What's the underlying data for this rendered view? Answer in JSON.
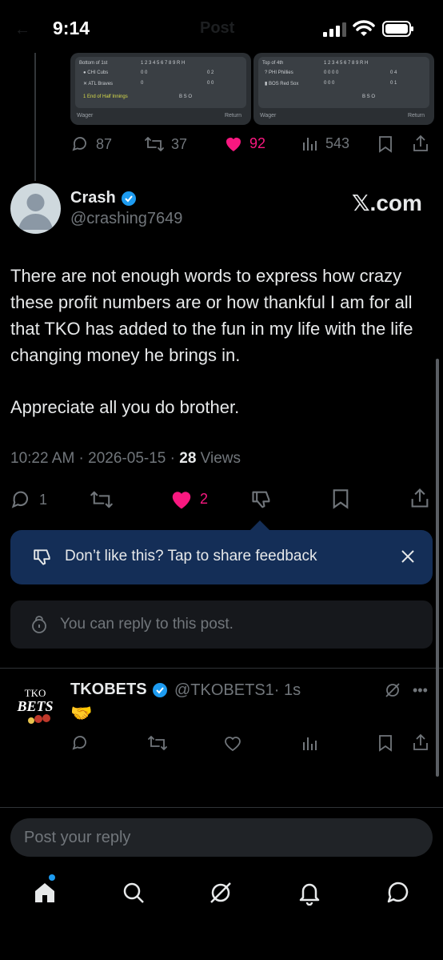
{
  "status_bar": {
    "time": "9:14",
    "ghost_title": "Post"
  },
  "quoted_cards": [
    {
      "inning": "Bottom of 1st",
      "innings_header": "1 2 3 4 5 6 7 8 9 R H",
      "teams": [
        {
          "name": "CHI Cubs",
          "scores": "0 0",
          "rh": "0 2"
        },
        {
          "name": "ATL Braves",
          "scores": "0",
          "rh": "0 0"
        }
      ],
      "status": "1 End of Half Innings",
      "count": "B S O",
      "wager_label": "Wager",
      "return_label": "Return"
    },
    {
      "inning": "Top of 4th",
      "innings_header": "1 2 3 4 5 6 7 8 9 R H",
      "teams": [
        {
          "name": "PHI Phillies",
          "scores": "0 0 0 0",
          "rh": "0 4"
        },
        {
          "name": "BOS Red Sox",
          "scores": "0 0 0",
          "rh": "0 1"
        }
      ],
      "count": "B S O",
      "wager_label": "Wager",
      "return_label": "Return"
    }
  ],
  "parent_actions": {
    "replies": "87",
    "reposts": "37",
    "likes": "92",
    "views": "543"
  },
  "post": {
    "author_name": "Crash",
    "author_handle": "@crashing7649",
    "source_mark": "𝕏.com",
    "text_line1": "There are not enough words to express how crazy these profit numbers are or how thankful I am for all that TKO has added to the fun in my life with the life changing money he brings in.",
    "text_line2": "Appreciate all you do brother.",
    "timestamp": "10:22 AM · 2026-05-15 · ",
    "views_count": "28",
    "views_label": " Views",
    "replies": "1",
    "likes": "2"
  },
  "feedback_banner": {
    "text": "Don’t like this? Tap to share feedback"
  },
  "reply_restriction": {
    "text": "You can reply to this post."
  },
  "reply": {
    "logo_top": "TKO",
    "logo_bottom": "BETS",
    "author_name": "TKOBETS",
    "author_handle": "@TKOBETS1",
    "time": "· 1s",
    "text": "🤝"
  },
  "composer": {
    "placeholder": "Post your reply"
  },
  "colors": {
    "accent": "#1d9bf0",
    "like": "#f91880",
    "banner": "#142e57"
  },
  "icons": [
    "home-icon",
    "search-icon",
    "grok-icon",
    "bell-icon",
    "messages-icon"
  ]
}
